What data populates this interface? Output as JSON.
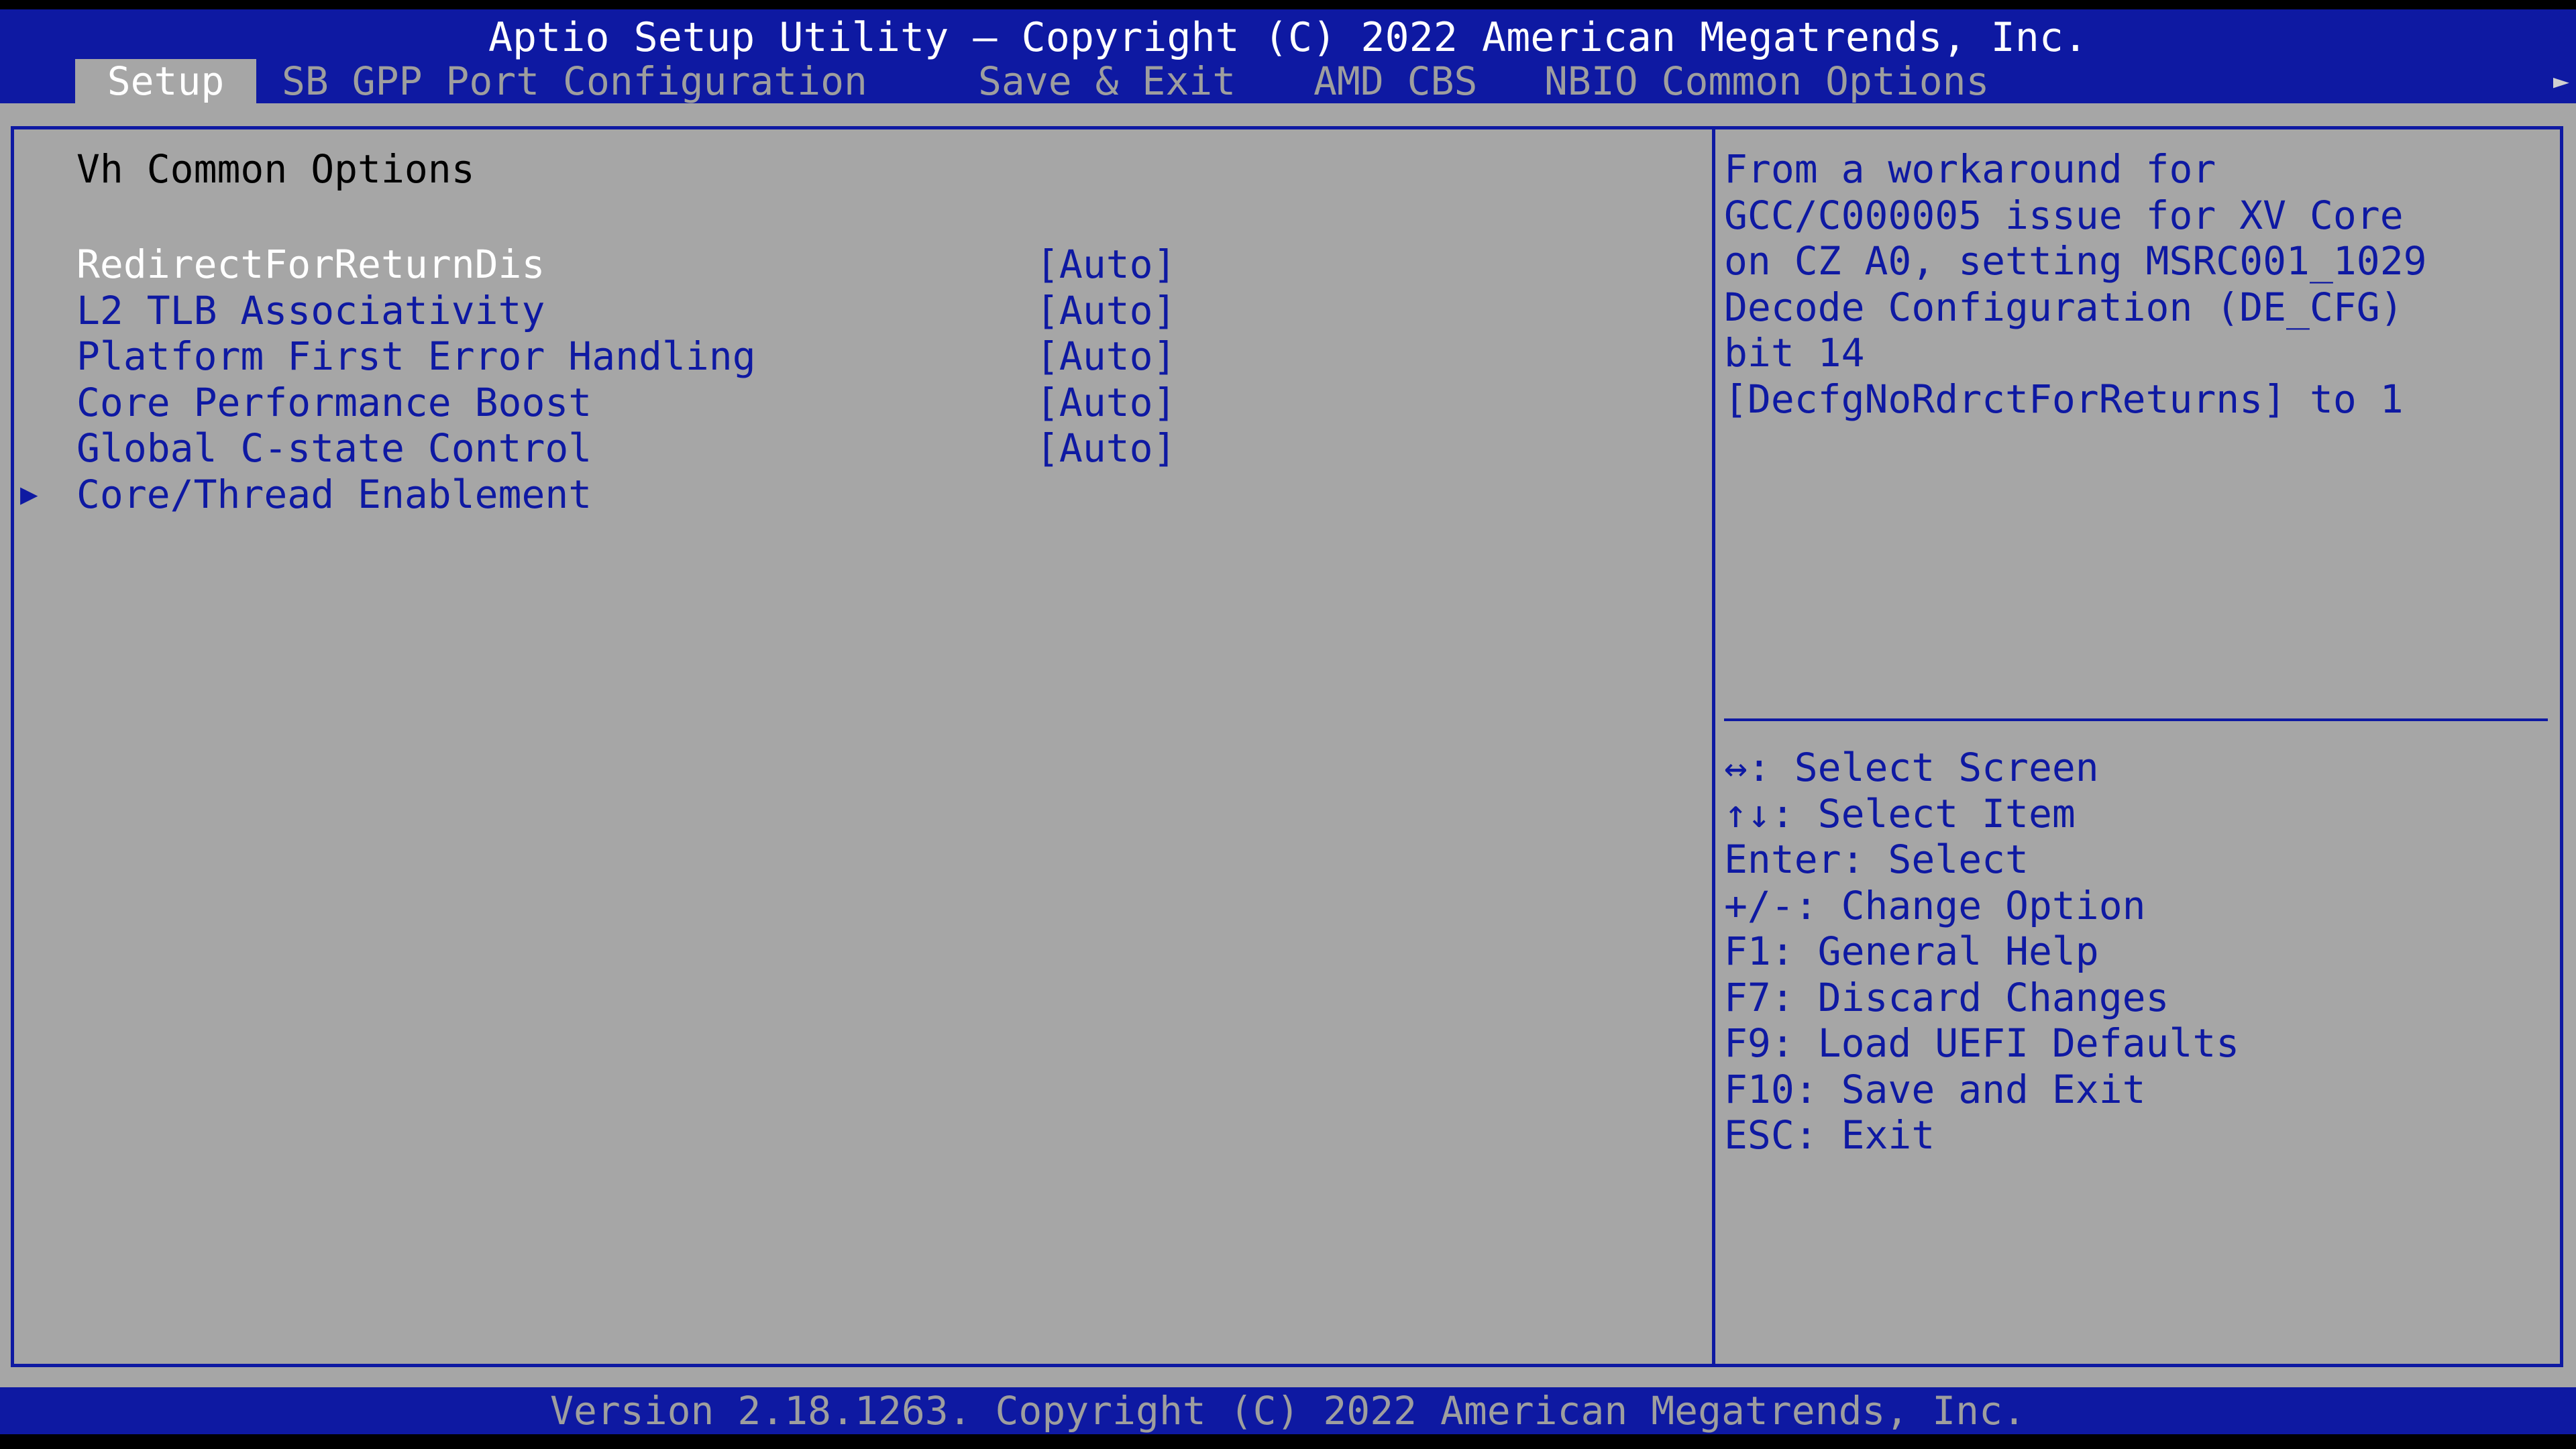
{
  "header": {
    "title": "Aptio Setup Utility – Copyright (C) 2022 American Megatrends, Inc.",
    "tabs": [
      {
        "label": "Setup",
        "active": true
      },
      {
        "label": "SB GPP Port Configuration",
        "active": false
      },
      {
        "label": "Save & Exit",
        "active": false
      },
      {
        "label": "AMD CBS",
        "active": false
      },
      {
        "label": "NBIO Common Options",
        "active": false
      }
    ],
    "more_arrow": "►"
  },
  "main": {
    "section_title": "Vh Common Options",
    "settings": [
      {
        "label": "RedirectForReturnDis",
        "value": "[Auto]",
        "selected": true
      },
      {
        "label": "L2 TLB Associativity",
        "value": "[Auto]",
        "selected": false
      },
      {
        "label": "Platform First Error Handling",
        "value": "[Auto]",
        "selected": false
      },
      {
        "label": "Core Performance Boost",
        "value": "[Auto]",
        "selected": false
      },
      {
        "label": "Global C-state Control",
        "value": "[Auto]",
        "selected": false
      },
      {
        "label": "Core/Thread Enablement",
        "value": "",
        "submenu": true,
        "arrow": "▶"
      }
    ]
  },
  "help": {
    "lines": [
      "From a workaround for",
      "GCC/C000005 issue for XV Core",
      "on CZ A0, setting MSRC001_1029",
      "Decode Configuration (DE_CFG)",
      "bit 14",
      "[DecfgNoRdrctForReturns] to 1"
    ],
    "keys": [
      "↔: Select Screen",
      "↑↓: Select Item",
      "Enter: Select",
      "+/-: Change Option",
      "F1: General Help",
      "F7: Discard Changes",
      "F9: Load UEFI Defaults",
      "F10: Save and Exit",
      "ESC: Exit"
    ]
  },
  "footer": {
    "text": "Version 2.18.1263. Copyright (C) 2022 American Megatrends, Inc."
  },
  "colors": {
    "bios_blue": "#0E19A2",
    "panel_gray": "#A6A6A6",
    "highlight_white": "#FFFFFF",
    "dim_gray": "#9E9E9E"
  }
}
